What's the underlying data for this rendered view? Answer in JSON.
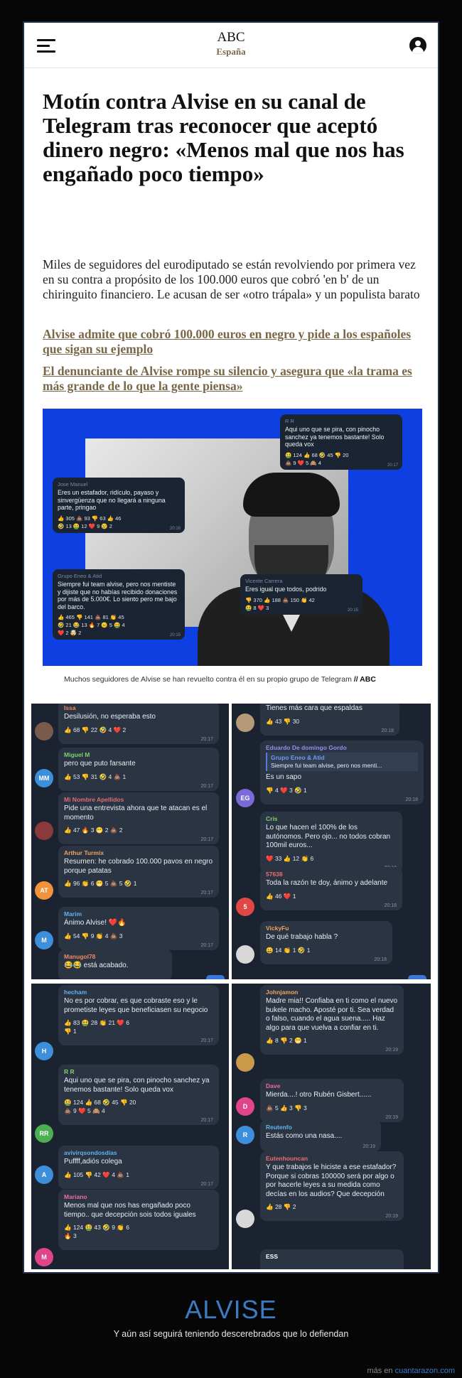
{
  "header": {
    "logo_top": "ABC",
    "logo_bottom": "España"
  },
  "article": {
    "headline": "Motín contra Alvise en su canal de Telegram tras reconocer que aceptó dinero negro: «Menos mal que nos has engañado poco tiempo»",
    "dek": "Miles de seguidores del eurodiputado se están revolviendo por primera vez en su contra a propósito de los 100.000 euros que cobró 'en b' de un chiringuito financiero. Le acusan de ser «otro trápala» y un populista barato",
    "related": [
      "Alvise admite que cobró 100.000 euros en negro y pide a los españoles que sigan su ejemplo",
      "El denunciante de Alvise rompe su silencio y asegura que «la trama es más grande de lo que la gente piensa»"
    ],
    "caption": "Muchos seguidores de Alvise se han revuelto contra él en su propio grupo de Telegram",
    "caption_credit": "// ABC"
  },
  "hero_bubbles": [
    {
      "name": "R R",
      "text": "Aqui uno que se pira, con pinocho sanchez ya tenemos bastante! Solo queda vox",
      "reactions": "🤮 124  👍 68  🤣 45  👎 20\n💩 9  ❤️ 5  🙈 4",
      "time": "20:17"
    },
    {
      "name": "Jose Manuel",
      "text": "Eres un estafador, ridículo, payaso y sinvergüenza que no llegará a ninguna parte, pringao",
      "reactions": "👍 305  💩 93  👎 63  👍 46\n🤣 13  🤮 12  ❤️ 9  😢 2",
      "time": "20:16"
    },
    {
      "name": "Grupo Eneo & Atid",
      "text": "Siempre fui team alvise, pero nos mentiste y dijiste que no habías recibido donaciones por más de 5.000€. Lo siento pero me bajo del barco.",
      "reactions": "👍 465  👎 141  💩 81  👏 45\n🤣 21  😂 13  🔥 7  😐 5  🤮 4\n❤️ 2  🤯 2",
      "time": "20:15"
    },
    {
      "name": "Vicente Carrera",
      "text": "Eres igual que todos, podrido",
      "reactions": "👎 370  👍 188  💩 150  👏 42\n🤮 8  ❤️ 3",
      "time": "20:15"
    }
  ],
  "chat_panels": [
    {
      "unread": "3294",
      "messages": [
        {
          "name": "Issa",
          "name_color": "#f08a5d",
          "text": "Desilusión, no esperaba esto",
          "reactions": "👍 68  👎 22  🤣 4  ❤️ 2",
          "time": "20:17"
        },
        {
          "name": "Miguel M",
          "name_color": "#7fd36b",
          "initials": "MM",
          "text": "pero que puto farsante",
          "reactions": "👍 53  👎 31  🤣 4  💩 1",
          "time": "20:17"
        },
        {
          "name": "Mi Nombre Apellidos",
          "name_color": "#e06c75",
          "text": "Pide una entrevista ahora que te atacan es el momento",
          "reactions": "👍 47  🔥 3  😁 2  💩 2",
          "time": "20:17"
        },
        {
          "name": "Arthur Turmix",
          "name_color": "#f0a35d",
          "initials": "AT",
          "text": "Resumen: he cobrado 100.000 pavos en negro porque patatas",
          "reactions": "👍 96  👏 6  😁 5  💩 5  🤣 1",
          "time": "20:17"
        },
        {
          "name": "Marim",
          "name_color": "#5db4f0",
          "initials": "M",
          "text": "Ánimo Alvise! ❤️🔥",
          "reactions": "👍 54  👎 9  👏 4  💩 3",
          "time": "20:17"
        },
        {
          "name": "Manugol78",
          "name_color": "#f08a5d",
          "text": "😂😂 está acabado.",
          "reactions": "",
          "time": ""
        }
      ]
    },
    {
      "unread": "3294",
      "messages": [
        {
          "name": "",
          "name_color": "#ffffff",
          "text": "Tienes más cara que espaldas",
          "reactions": "👍 43  👎 30",
          "time": "20:18"
        },
        {
          "name": "Eduardo De domingo Gordo",
          "name_color": "#9a8cf0",
          "initials": "EG",
          "quote_name": "Grupo Eneo & Atid",
          "quote_text": "Siempre fui team alvise, pero nos menti...",
          "text": "Es un sapo",
          "reactions": "👎 4  ❤️ 3  🤣 1",
          "time": "20:18"
        },
        {
          "name": "Cris",
          "name_color": "#7fd36b",
          "text": "Lo que hacen el 100% de los autónomos. Pero ojo... no todos cobran 100mil euros...",
          "reactions": "❤️ 33  👍 12  👏 6",
          "time": "20:18"
        },
        {
          "name": "57638",
          "name_color": "#f06c6c",
          "initials": "5",
          "text": "Toda la razón te doy, ánimo y adelante",
          "reactions": "👍 46  ❤️ 1",
          "time": "20:18"
        },
        {
          "name": "VickyFu",
          "name_color": "#f0a35d",
          "text": "De qué trabajo habla ?",
          "reactions": "😀 14  👏 1  🤣 1",
          "time": "20:18"
        }
      ]
    },
    {
      "unread": "",
      "messages": [
        {
          "name": "hecham",
          "name_color": "#5db4f0",
          "initials": "H",
          "text": "No es por cobrar, es que cobraste eso y le prometiste leyes que beneficiasen su negocio",
          "reactions": "👍 83  🤮 28  👏 21  ❤️ 6\n👎 1",
          "time": "20:17"
        },
        {
          "name": "R R",
          "name_color": "#7fd36b",
          "initials": "RR",
          "text": "Aqui uno que se pira, con pinocho sanchez ya tenemos bastante! Solo queda vox",
          "reactions": "🤮 124  👍 68  🤣 45  👎 20\n💩 9  ❤️ 5  🙈 4",
          "time": "20:17"
        },
        {
          "name": "avivirqsondosdias",
          "name_color": "#5db4f0",
          "initials": "A",
          "text": "Puffff,adiós colega",
          "reactions": "👍 105  👎 42  ❤️ 4  💩 1",
          "time": "20:17"
        },
        {
          "name": "Mariano",
          "name_color": "#f06c9c",
          "initials": "M",
          "text": "Menos mal que nos has engañado poco tiempo.. que decepción sois todos iguales",
          "reactions": "👍 124  🤮 43  🤣 9  👏 6\n🔥 3",
          "time": ""
        }
      ]
    },
    {
      "unread": "",
      "messages": [
        {
          "name": "Johnjamon",
          "name_color": "#f0a35d",
          "text": "Madre mia!! Confiaba en ti como el nuevo bukele macho. Aposté por ti. Sea verdad o falso, cuando el agua suena..... Haz algo para que vuelva a confiar en ti.",
          "reactions": "👍 8  👎 2  😁 1",
          "time": "20:19"
        },
        {
          "name": "Dave",
          "name_color": "#f06c9c",
          "initials": "D",
          "text": "Mierda....! otro Rubén Gisbert......",
          "reactions": "💩 5  👍 3  👎 3",
          "time": "20:19"
        },
        {
          "name": "Reutenfo",
          "name_color": "#5db4f0",
          "initials": "R",
          "text": "Estás como una nasa....",
          "reactions": "",
          "time": "20:19"
        },
        {
          "name": "Eutenhouncan",
          "name_color": "#f06c6c",
          "text": "Y que trabajos le hiciste a ese estafador? Porque si cobras 100000 será por algo o por hacerle leyes a su medida como decías en los audios? Que decepción",
          "reactions": "👍 28  👎 2",
          "time": "20:19"
        },
        {
          "name": "ESS",
          "name_color": "#ffffff",
          "text": "",
          "reactions": "",
          "time": ""
        }
      ]
    }
  ],
  "footer": {
    "title": "ALVISE",
    "subtitle": "Y aún así seguirá teniendo descerebrados que lo defiendan",
    "credit_prefix": "más en ",
    "credit_link": "cuantarazon.com"
  }
}
